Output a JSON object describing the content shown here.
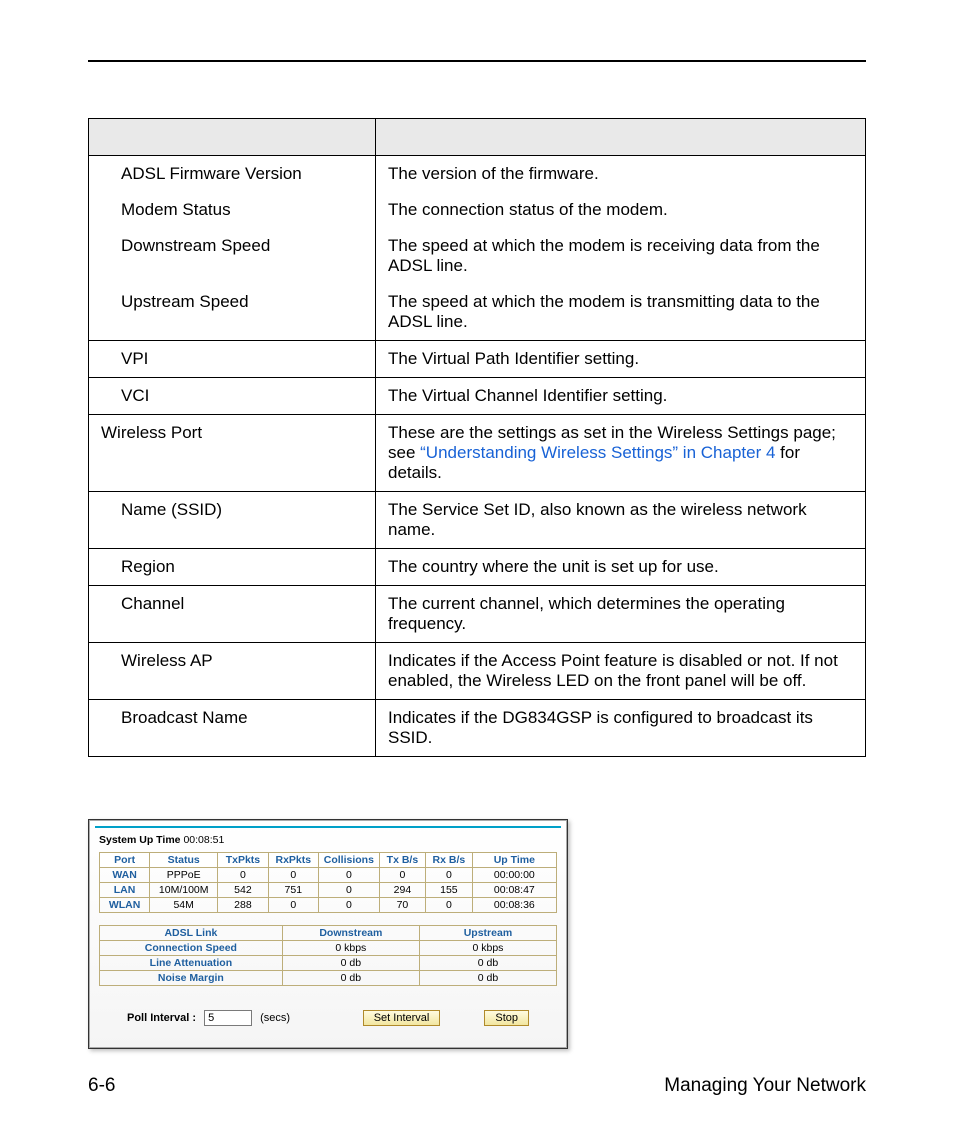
{
  "desc_table": {
    "rows": [
      {
        "name": "ADSL Firmware Version",
        "desc": "The version of the firmware.",
        "indent": 2,
        "sep": true
      },
      {
        "name": "Modem Status",
        "desc": "The connection status of the modem.",
        "indent": 2
      },
      {
        "name": "Downstream Speed",
        "desc": "The speed at which the modem is receiving data from the ADSL line.",
        "indent": 2
      },
      {
        "name": "Upstream Speed",
        "desc": "The speed at which the modem is transmitting data to the ADSL line.",
        "indent": 2
      },
      {
        "name": "VPI",
        "desc": "The Virtual Path Identifier setting.",
        "indent": 2,
        "sep": true
      },
      {
        "name": "VCI",
        "desc": "The Virtual Channel Identifier setting.",
        "indent": 2,
        "sep": true
      },
      {
        "name": "Wireless Port",
        "desc_pre": "These are the settings as set in the Wireless Settings page; see ",
        "link": "“Understanding Wireless Settings” in Chapter 4",
        "desc_post": " for details.",
        "indent": 1,
        "sep": true
      },
      {
        "name": "Name (SSID)",
        "desc": "The Service Set ID, also known as the wireless network name.",
        "indent": 2,
        "sep": true
      },
      {
        "name": "Region",
        "desc": "The country where the unit is set up for use.",
        "indent": 2,
        "sep": true
      },
      {
        "name": "Channel",
        "desc": "The current channel, which determines the operating frequency.",
        "indent": 2,
        "sep": true
      },
      {
        "name": "Wireless AP",
        "desc": "Indicates if the Access Point feature is disabled or not. If not enabled, the Wireless LED on the front panel will be off.",
        "indent": 2,
        "sep": true
      },
      {
        "name": "Broadcast Name",
        "desc": "Indicates if the DG834GSP is configured to broadcast its SSID.",
        "indent": 2,
        "sep": true,
        "last": true
      }
    ]
  },
  "panel": {
    "uptime_label": "System Up Time",
    "uptime_value": "00:08:51",
    "port_headers": [
      "Port",
      "Status",
      "TxPkts",
      "RxPkts",
      "Collisions",
      "Tx B/s",
      "Rx B/s",
      "Up Time"
    ],
    "port_rows": [
      {
        "port": "WAN",
        "cells": [
          "PPPoE",
          "0",
          "0",
          "0",
          "0",
          "0",
          "00:00:00"
        ]
      },
      {
        "port": "LAN",
        "cells": [
          "10M/100M",
          "542",
          "751",
          "0",
          "294",
          "155",
          "00:08:47"
        ]
      },
      {
        "port": "WLAN",
        "cells": [
          "54M",
          "288",
          "0",
          "0",
          "70",
          "0",
          "00:08:36"
        ]
      }
    ],
    "adsl_headers": [
      "ADSL Link",
      "Downstream",
      "Upstream"
    ],
    "adsl_rows": [
      {
        "label": "Connection Speed",
        "down": "0 kbps",
        "up": "0 kbps"
      },
      {
        "label": "Line Attenuation",
        "down": "0 db",
        "up": "0 db"
      },
      {
        "label": "Noise Margin",
        "down": "0 db",
        "up": "0 db"
      }
    ],
    "poll": {
      "label": "Poll Interval :",
      "value": "5",
      "unit": "(secs)",
      "set_button": "Set Interval",
      "stop_button": "Stop"
    }
  },
  "footer": {
    "left": "6-6",
    "right": "Managing Your Network"
  }
}
